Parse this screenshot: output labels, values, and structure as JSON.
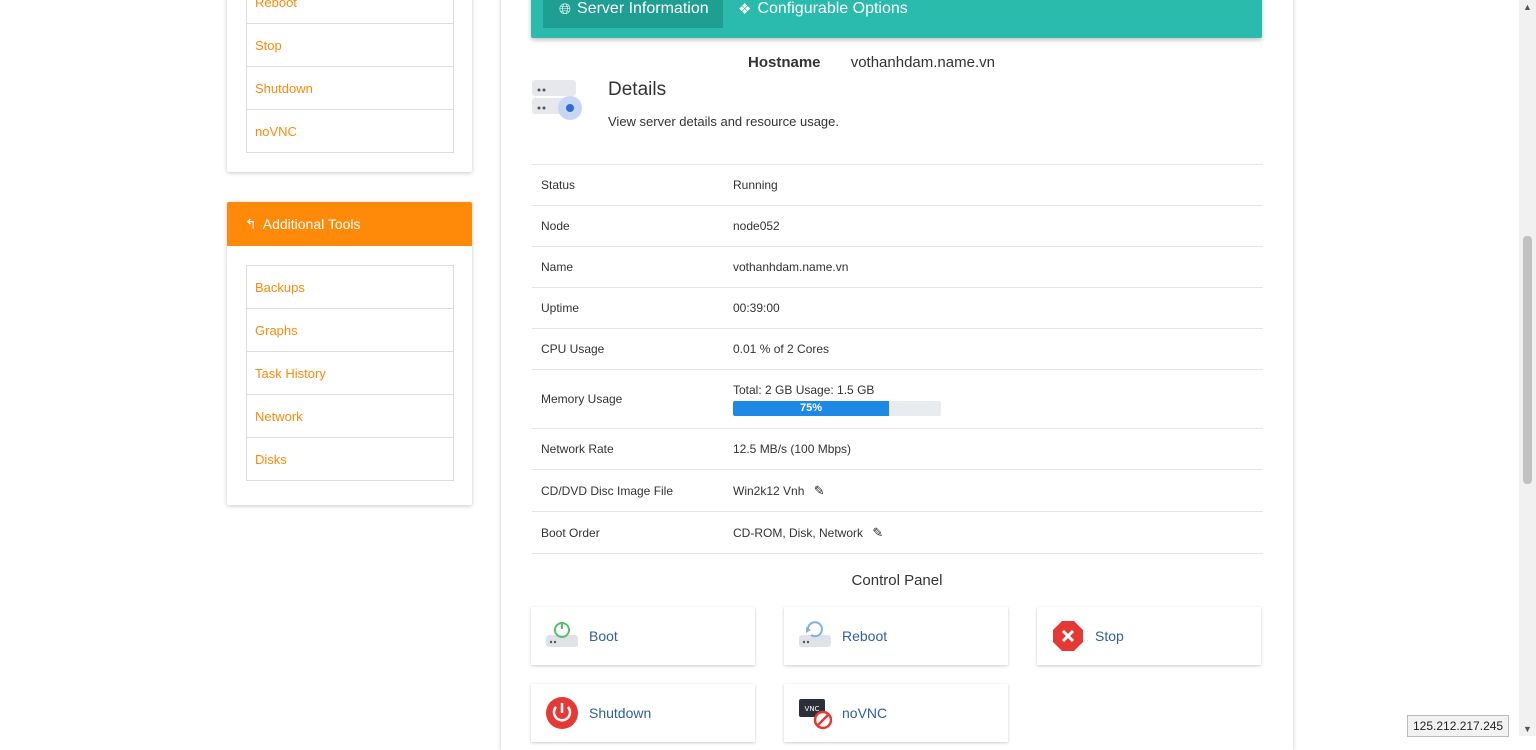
{
  "sidebar": {
    "power_menu": [
      "Reboot",
      "Stop",
      "Shutdown",
      "noVNC"
    ],
    "tools_title": "Additional Tools",
    "tools_menu": [
      "Backups",
      "Graphs",
      "Task History",
      "Network",
      "Disks"
    ]
  },
  "tabs": {
    "server_info": "Server Information",
    "configurable_options": "Configurable Options"
  },
  "hostname": {
    "label": "Hostname",
    "value": "vothanhdam.name.vn"
  },
  "details": {
    "title": "Details",
    "subtitle": "View server details and resource usage."
  },
  "info_rows": [
    {
      "key": "Status",
      "value": "Running"
    },
    {
      "key": "Node",
      "value": "node052"
    },
    {
      "key": "Name",
      "value": "vothanhdam.name.vn"
    },
    {
      "key": "Uptime",
      "value": "00:39:00"
    },
    {
      "key": "CPU Usage",
      "value": "0.01 % of 2 Cores"
    },
    {
      "key": "Memory Usage",
      "value": "Total: 2 GB Usage: 1.5 GB",
      "progress_label": "75%",
      "progress_fraction": 0.75
    },
    {
      "key": "Network Rate",
      "value": "12.5 MB/s (100 Mbps)"
    },
    {
      "key": "CD/DVD Disc Image File",
      "value": "Win2k12 Vnh"
    },
    {
      "key": "Boot Order",
      "value": "CD-ROM, Disk, Network"
    }
  ],
  "control_panel": {
    "title": "Control Panel",
    "buttons": [
      "Boot",
      "Reboot",
      "Stop",
      "Shutdown",
      "noVNC"
    ]
  },
  "ip_address": "125.212.217.245",
  "colors": {
    "orange": "#ff8a09",
    "teal": "#2bbbad",
    "progress": "#1e88e5",
    "running": "#2e7d32"
  }
}
